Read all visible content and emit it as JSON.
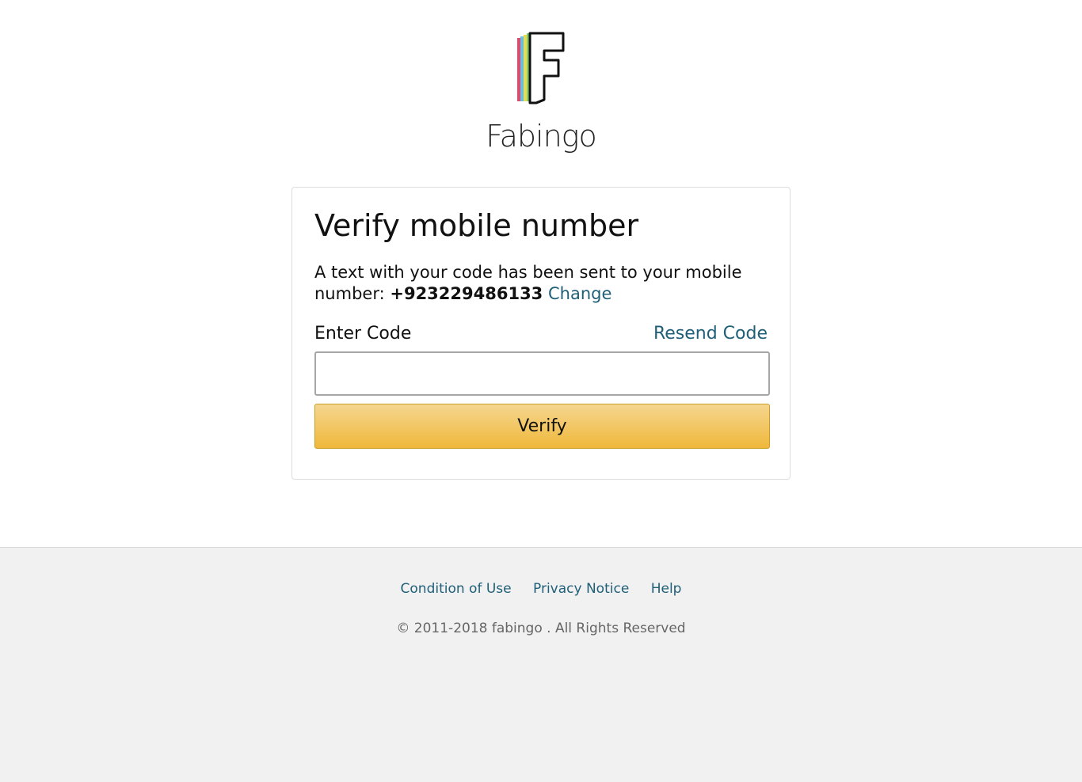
{
  "brand": {
    "name": "Fabingo",
    "logo_icon": "fabingo-f-logo-icon"
  },
  "card": {
    "title": "Verify mobile number",
    "message": "A text with your code has been sent to your mobile number:",
    "phone": "+923229486133",
    "change_label": "Change",
    "code_label": "Enter Code",
    "resend_label": "Resend Code",
    "code_value": "",
    "verify_label": "Verify"
  },
  "footer": {
    "links": [
      "Condition of Use",
      "Privacy Notice",
      "Help"
    ],
    "copyright": "© 2011-2018 fabingo . All Rights Reserved"
  },
  "colors": {
    "link": "#1f5f78",
    "button_top": "#f5d68f",
    "button_bottom": "#efb83b",
    "footer_bg": "#f1f1f1"
  }
}
